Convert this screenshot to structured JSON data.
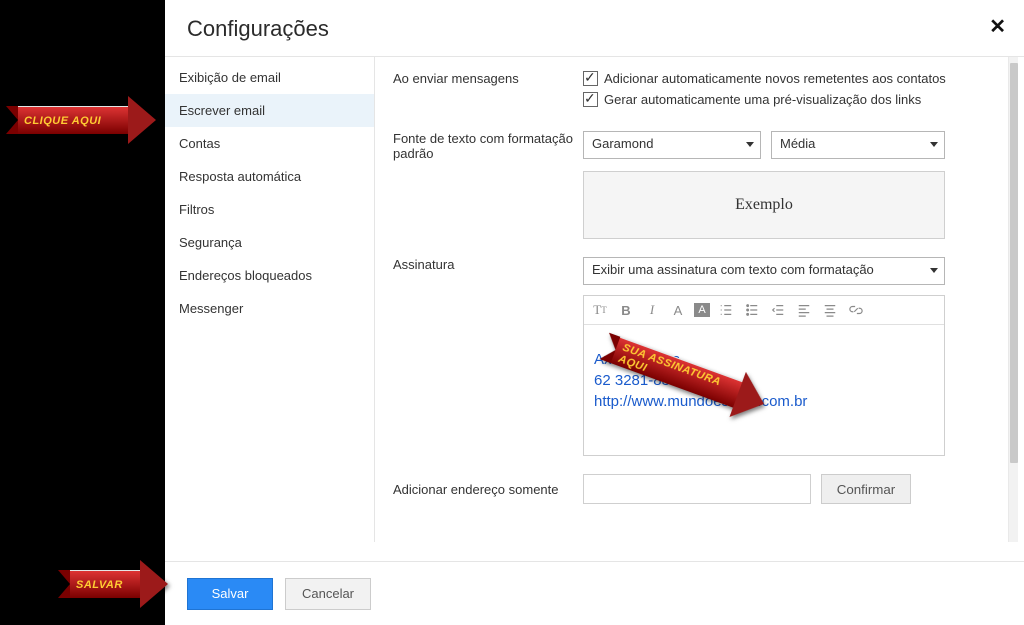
{
  "header": {
    "title": "Configurações"
  },
  "sidebar": {
    "items": [
      {
        "label": "Exibição de email"
      },
      {
        "label": "Escrever email"
      },
      {
        "label": "Contas"
      },
      {
        "label": "Resposta automática"
      },
      {
        "label": "Filtros"
      },
      {
        "label": "Segurança"
      },
      {
        "label": "Endereços bloqueados"
      },
      {
        "label": "Messenger"
      }
    ],
    "selected_index": 1
  },
  "settings": {
    "send_label": "Ao enviar mensagens",
    "chk_add_contacts": "Adicionar automaticamente novos remetentes aos contatos",
    "chk_link_preview": "Gerar automaticamente uma pré-visualização dos links",
    "font_label": "Fonte de texto com formatação padrão",
    "font_value": "Garamond",
    "size_value": "Média",
    "example_label": "Exemplo",
    "signature_label": "Assinatura",
    "signature_mode": "Exibir uma assinatura com texto com formatação",
    "signature_name": "Axel Guedes",
    "signature_phone": "62 3281-8357",
    "signature_url": "http://www.mundoescrito.com.br",
    "add_addr_label": "Adicionar endereço somente",
    "confirm_label": "Confirmar"
  },
  "footer": {
    "save": "Salvar",
    "cancel": "Cancelar"
  },
  "annotations": {
    "a1": "CLIQUE  AQUI",
    "a2": "SUA ASSINATURA AQUI",
    "a3": "SALVAR"
  }
}
